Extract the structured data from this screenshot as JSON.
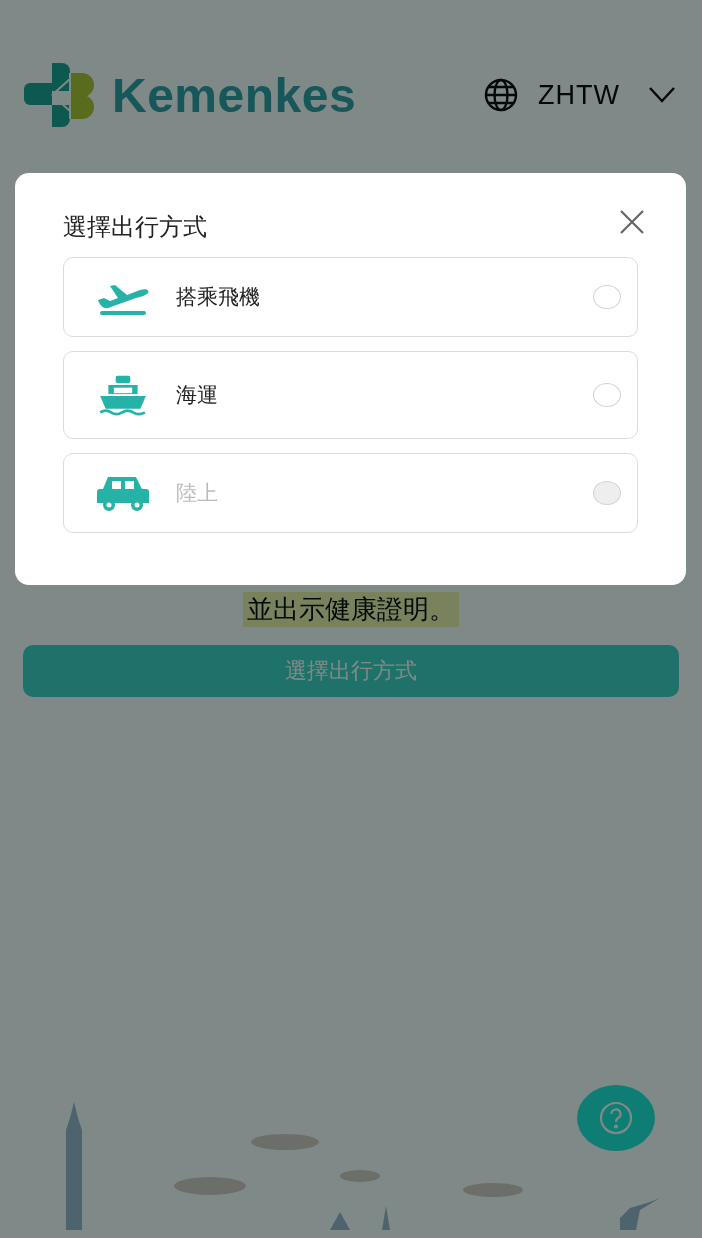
{
  "header": {
    "logo_text": "Kemenkes",
    "language": "ZHTW"
  },
  "page": {
    "notice": "並出示健康證明。",
    "button": "選擇出行方式"
  },
  "modal": {
    "title": "選擇出行方式",
    "options": [
      {
        "kind": "plane",
        "label": "搭乘飛機",
        "selected": false,
        "disabled": false
      },
      {
        "kind": "ship",
        "label": "海運",
        "selected": false,
        "disabled": false
      },
      {
        "kind": "car",
        "label": "陸上",
        "selected": false,
        "disabled": true
      }
    ]
  }
}
